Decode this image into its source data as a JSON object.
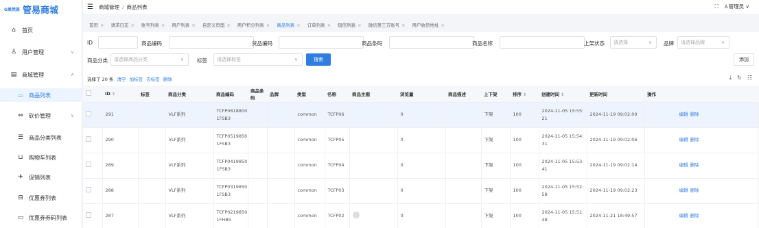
{
  "brand": {
    "mark": "G果然商",
    "name": "管易商城"
  },
  "sidebar": {
    "items": [
      {
        "label": "首页"
      },
      {
        "label": "用户管理"
      },
      {
        "label": "商城管理"
      },
      {
        "label": "商品列表"
      },
      {
        "label": "砍价管理"
      },
      {
        "label": "商品分类列表"
      },
      {
        "label": "购物车列表"
      },
      {
        "label": "促销列表"
      },
      {
        "label": "优惠券列表"
      },
      {
        "label": "优惠券券码列表"
      }
    ]
  },
  "header": {
    "breadcrumb": [
      "商城管理",
      "商品列表"
    ],
    "user": "管理员"
  },
  "tabs": [
    "首页",
    "请求日志",
    "账号列表",
    "用户列表",
    "自定义页面",
    "用户积分列表",
    "商品列表",
    "订单列表",
    "短信列表",
    "微信第三方账号",
    "用户收货地址"
  ],
  "filters": {
    "id_label": "ID",
    "code_label": "商品编码",
    "cargo_label": "货品编码",
    "barcode_label": "商品条码",
    "name_label": "商品名称",
    "status_label": "上架状态",
    "status_placeholder": "请选择",
    "brand_label": "品牌",
    "brand_placeholder": "请选择品牌",
    "category_label": "商品分类",
    "category_placeholder": "请选择商品分类",
    "tag_label": "标签",
    "tag_placeholder": "请选择标签",
    "search_button": "搜索",
    "add_button": "添加"
  },
  "selection": {
    "text": "选择了 20 条",
    "clear": "清空",
    "add_tag": "加标签",
    "remove_tag": "去标签",
    "delete": "删除"
  },
  "table": {
    "columns": [
      "ID",
      "标签",
      "商品分类",
      "商品编码",
      "商品条码",
      "品牌",
      "类型",
      "名称",
      "商品主图",
      "浏览量",
      "商品描述",
      "上下架",
      "排序",
      "创建时间",
      "更新时间",
      "操作"
    ],
    "rows": [
      {
        "id": "291",
        "category": "VLF系列",
        "code1": "TCFP0618800",
        "code2": "1FSB3",
        "type": "common",
        "name": "TCFP06",
        "views": "0",
        "status": "下架",
        "sort": "100",
        "created1": "2024-11-05 15:55:",
        "created2": "21",
        "updated": "2024-11-19 09:02:00",
        "edit": "编辑",
        "del": "删除"
      },
      {
        "id": "290",
        "category": "VLF系列",
        "code1": "TCFP0519850",
        "code2": "1FSB3",
        "type": "common",
        "name": "TCFP05",
        "views": "0",
        "status": "下架",
        "sort": "100",
        "created1": "2024-11-05 15:54:",
        "created2": "31",
        "updated": "2024-11-19 09:02:06",
        "edit": "编辑",
        "del": "删除"
      },
      {
        "id": "289",
        "category": "VLF系列",
        "code1": "TCFP0419850",
        "code2": "1FSB3",
        "type": "common",
        "name": "TCFP04",
        "views": "0",
        "status": "下架",
        "sort": "100",
        "created1": "2024-11-05 15:53:",
        "created2": "41",
        "updated": "2024-11-19 09:02:14",
        "edit": "编辑",
        "del": "删除"
      },
      {
        "id": "288",
        "category": "VLF系列",
        "code1": "TCFP0319850",
        "code2": "1FSB3",
        "type": "common",
        "name": "TCFP03",
        "views": "0",
        "status": "下架",
        "sort": "100",
        "created1": "2024-11-05 15:52:",
        "created2": "58",
        "updated": "2024-11-19 09:02:23",
        "edit": "编辑",
        "del": "删除"
      },
      {
        "id": "287",
        "category": "VLF系列",
        "code1": "TCFP0219850",
        "code2": "1FHB5",
        "type": "common",
        "name": "TCFP02",
        "views": "0",
        "status": "下架",
        "sort": "100",
        "created1": "2024-11-05 15:51:",
        "created2": "48",
        "updated": "2024-11-21 18:49:57",
        "edit": "编辑",
        "del": "删除"
      }
    ]
  }
}
